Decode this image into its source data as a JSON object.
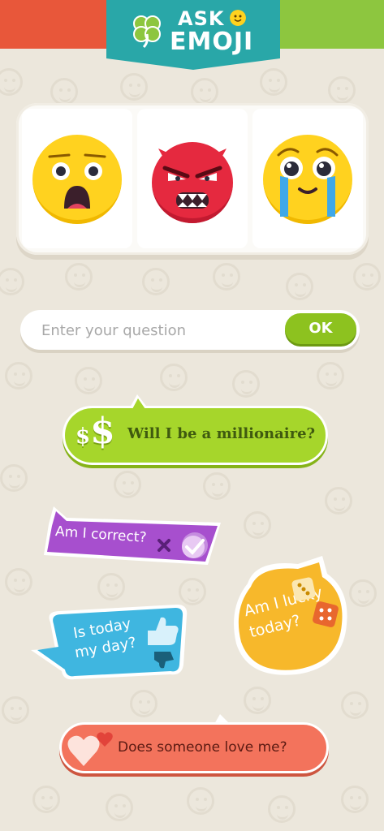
{
  "header": {
    "logo_line1": "ASK",
    "logo_line2": "EMOJI"
  },
  "slots": [
    {
      "icon": "shocked-face-icon"
    },
    {
      "icon": "angry-devil-icon"
    },
    {
      "icon": "crying-face-icon"
    }
  ],
  "question": {
    "placeholder": "Enter your question",
    "value": "",
    "ok_label": "OK"
  },
  "suggestions": [
    {
      "text": "Will I be a millionaire?",
      "color": "#a6d62b",
      "icon": "dollar-icon"
    },
    {
      "text": "Am I correct?",
      "color": "#a74fce",
      "icon": "check-icon"
    },
    {
      "text": "Is today my day?",
      "color": "#3fb6e0",
      "icon": "thumbs-icon"
    },
    {
      "text": "Am I lucky today?",
      "color": "#f7b82b",
      "icon": "dice-icon"
    },
    {
      "text": "Does someone love me?",
      "color": "#f3735c",
      "icon": "hearts-icon"
    }
  ],
  "colors": {
    "background": "#ece7dc",
    "header_left": "#e8573a",
    "header_right": "#8dc63f",
    "logo_plate": "#29a7a8",
    "ok_button": "#8dc21f"
  }
}
